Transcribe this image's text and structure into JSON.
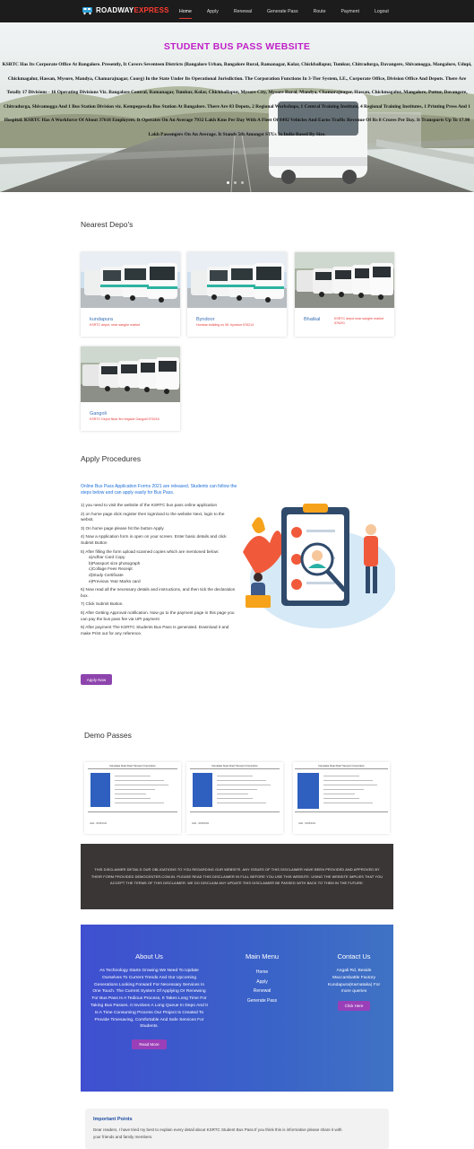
{
  "nav": {
    "brand_prefix": "ROADWAY",
    "brand_accent": "EXPRESS",
    "links": [
      "Home",
      "Apply",
      "Renewal",
      "Generate Pass",
      "Route",
      "Payment",
      "Logout"
    ],
    "active": "Home"
  },
  "hero": {
    "title": "STUDENT BUS PASS WEBSITE",
    "text": "KSRTC Has Its Corporate Office At Bangalore. Presently, It Covers Seventeen Districts (Bangalore Urban, Bangalore Rural, Ramanagar, Kolar, Chickballapur, Tumkur, Chitradurga, Davangere, Shivamogga, Mangalore, Udupi, Chickmagalur, Hassan, Mysore, Mandya, Chamarajnagar, Coorg) In the State Under Its Operational Jurisdiction. The Corporation Functions In 3-Tier System, I.E., Corporate Office, Division Office And Depots. There Are Totally 17 Divisions - 16 Operating Divisions Viz. Bangalore Central, Ramanagar, Tumkur, Kolar, Chickballapur, Mysore City, Mysore Rural, Mandya, Chamarajnagar, Hassan, Chickmagalur, Mangalore, Puttur, Davangere, Chitradurga, Shivamogga And 1 Bus Station Division viz. Kempegowda Bus Station At Bangalore. There Are 83 Depots, 2 Regional Workshops, 1 Central Training Institute, 4 Regional Training Institutes, 1 Printing Press And 1 Hospital. KSRTC Has A Workforce Of About 37618 Employees. It Operates On An Average 7932 Lakh Kms Per Day With A Fleet Of 8492 Vehicles And Earns Traffic Revenue Of Rs 8 Crores Per Day. It Transports Up To 17.98 Lakh Passengers On An Average. It Stands 5th Amongst STUs In India Based By Size.",
    "dots": 3
  },
  "depos": {
    "heading": "Nearest Depo's",
    "items": [
      {
        "name": "kundapura",
        "address": "KSRTC depot, near sanghe market"
      },
      {
        "name": "Byndoor",
        "address": "Hombar building no 55, byndoor 576214"
      },
      {
        "name": "Bhatkal",
        "address": "KSRTC depot near sanghe market 576201"
      },
      {
        "name": "Gangoli",
        "address": "KSRTC Depot Near fire brigade Gangolli 576216"
      }
    ]
  },
  "apply": {
    "heading": "Apply Procedures",
    "intro": "Online Bus Pass Application Forms 2021 are released, Students can follow the steps below and can apply easily for Bus Pass.",
    "steps": [
      "1) you need to visit the website of the KSRTC bus pass online application",
      "2) on home page click register then logIn/and to the website Next, login to the websit.",
      "3) On home page please hit the button Apply",
      "4) Now a Application form is open on your screen. Enter basic details and click Submit Button",
      "5) After filling the form upload scanned copies which are mentioned below:"
    ],
    "docs": [
      "a)Adhar Card Copy",
      "b)Passport size photograph",
      "c)Collage Fees Receipt",
      "d)Study Certificate",
      "e)Previous Year Marks card"
    ],
    "steps_after": [
      "6) Now read all the necessary details and instructions, and then tick the declaration box.",
      "7) Click Submit Button.",
      "8) After Getting Approval notification. Now go to the payment page in this page you can pay the bus pass fee via UPI payment",
      "9) After payment The KSRTC Students Bus Pass Is generated. Download it and make Print out for any reference."
    ],
    "button": "Apply Now"
  },
  "demo": {
    "heading": "Demo Passes",
    "pass_header": "Karnataka State Road Transport Corporation",
    "pass_footer_left": "Valid - 30/05/2021",
    "pass_footer_right": "Sign"
  },
  "disclaimer": {
    "text": "THIS DISCLAIMER DETAILS OUR OBLIGATIONS TO YOU REGARDING OUR WEBSITE. ANY ISSUES OF THIS DISCLAIMER HAVE BEEN PROVIDED AND APPROVED BY THEIR FORM PROVIDED DEMOCENTER.COM.IN. PLEASE READ THIS DISCLAIMER IN FULL BEFORE YOU USE THIS WEBSITE. USING THE WEBSITE IMPLIES THAT YOU ACCEPT THE TERMS OF THIS DISCLAIMER. WE DO DISCLAIM ANY UPDATE THIS DISCLAIMER BE PASSED WITH BACK TO THEM IN THE FUTURE."
  },
  "footer": {
    "about_title": "About Us",
    "about_text": "As Technology Starts Growing We Need To Update Ourselves To Current Trends And Our Upcoming Generations Looking Forward For Necessary Services In One Touch. The Current System Of Applying Or Renewing For Bus Pass Is A Tedious Process, It Takes Long Time For Taking Bus Passes. It Involves A Long Queue In Depo And It Is A Time Consuming Process Our Project Is Created To Provide Timesaving, Comfortable And Safe Services For Students.",
    "about_button": "Read More",
    "menu_title": "Main Menu",
    "menu_links": [
      "Home",
      "Apply",
      "Renewal",
      "Generate Pass"
    ],
    "contact_title": "Contact Us",
    "contact_text": "Angali Rd, Beside Maccambattle Factory Kundapura(Karnataka) For more queries",
    "contact_button": "Click Here"
  },
  "important": {
    "title": "Important Points",
    "text": "Dear readers, I have tried my best to explain every detail about KSRTC Student Bus Pass.If you think this is informative please share it with your friends and family members."
  },
  "colors": {
    "accent_red": "#e53935",
    "hero_title": "#c020c8",
    "link_blue": "#3a6fb5",
    "button_purple": "#8e44ad",
    "footer_blue": "#3a63c8",
    "disclaimer_bg": "#3a3636"
  }
}
